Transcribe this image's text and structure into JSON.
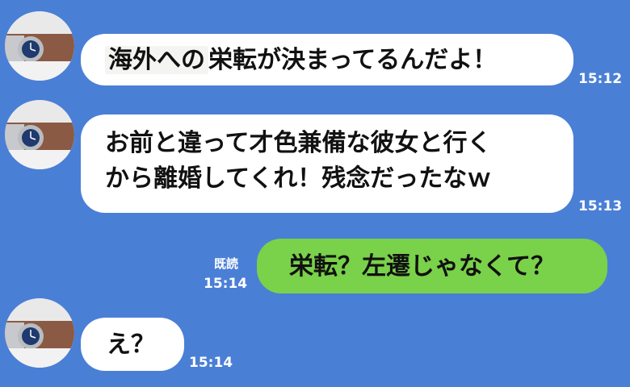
{
  "messages": [
    {
      "side": "incoming",
      "text_highlight": "海外への",
      "text_rest": "栄転が決まってるんだよ！",
      "time": "15:12"
    },
    {
      "side": "incoming",
      "line1": "お前と違って才色兼備な彼女と行く",
      "line2": "から離婚してくれ！残念だったなｗ",
      "time": "15:13"
    },
    {
      "side": "outgoing",
      "text": "栄転？左遷じゃなくて？",
      "read_label": "既読",
      "time": "15:14"
    },
    {
      "side": "incoming",
      "text": "え？",
      "time": "15:14"
    }
  ],
  "colors": {
    "background": "#4a7fd6",
    "incoming_bubble": "#ffffff",
    "outgoing_bubble": "#7ad14a"
  },
  "icons": {
    "avatar": "wristwatch-avatar-icon"
  }
}
